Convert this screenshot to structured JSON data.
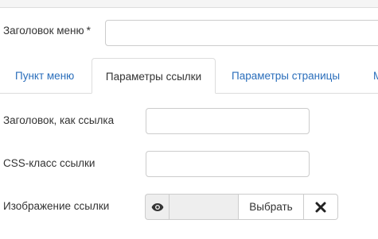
{
  "form": {
    "title_label": "Заголовок меню",
    "required_mark": "*",
    "title_value": ""
  },
  "tabs": [
    {
      "label": "Пункт меню",
      "active": false
    },
    {
      "label": "Параметры ссылки",
      "active": true
    },
    {
      "label": "Параметры страницы",
      "active": false
    },
    {
      "label": "M",
      "active": false
    }
  ],
  "link_params": {
    "link_title_label": "Заголовок, как ссылка",
    "link_title_value": "",
    "css_class_label": "CSS-класс ссылки",
    "css_class_value": "",
    "image_label": "Изображение ссылки",
    "image_value": "",
    "preview_icon": "eye-icon",
    "select_label": "Выбрать",
    "clear_icon": "close-icon"
  },
  "colors": {
    "link": "#2a6ebb",
    "text": "#333333",
    "border": "#cccccc",
    "addon_bg": "#eeeeee"
  }
}
